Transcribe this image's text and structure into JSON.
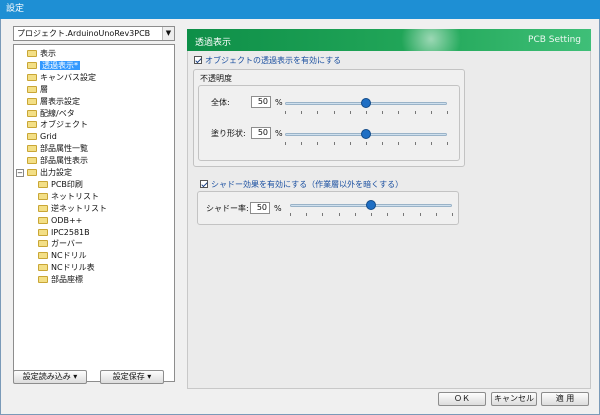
{
  "window": {
    "title": "設定"
  },
  "project_select": {
    "value": "プロジェクト.ArduinoUnoRev3PCB"
  },
  "tree": {
    "items": [
      {
        "label": "表示",
        "level": 0
      },
      {
        "label": "透過表示*",
        "level": 0,
        "selected": true
      },
      {
        "label": "キャンバス設定",
        "level": 0
      },
      {
        "label": "層",
        "level": 0
      },
      {
        "label": "層表示設定",
        "level": 0
      },
      {
        "label": "配線/ベタ",
        "level": 0
      },
      {
        "label": "オブジェクト",
        "level": 0
      },
      {
        "label": "Grid",
        "level": 0
      },
      {
        "label": "部品属性一覧",
        "level": 0
      },
      {
        "label": "部品属性表示",
        "level": 0
      },
      {
        "label": "出力設定",
        "level": 0,
        "expander": "−"
      },
      {
        "label": "PCB印刷",
        "level": 1
      },
      {
        "label": "ネットリスト",
        "level": 1
      },
      {
        "label": "逆ネットリスト",
        "level": 1
      },
      {
        "label": "ODB++",
        "level": 1
      },
      {
        "label": "IPC2581B",
        "level": 1
      },
      {
        "label": "ガーバー",
        "level": 1
      },
      {
        "label": "NCドリル",
        "level": 1
      },
      {
        "label": "NCドリル表",
        "level": 1
      },
      {
        "label": "部品座標",
        "level": 1
      }
    ]
  },
  "bottom_left": {
    "load_label": "設定読み込み ▾",
    "save_label": "設定保存 ▾"
  },
  "panel": {
    "title": "透過表示",
    "brand": "PCB Setting",
    "transparency_check": "オブジェクトの透過表示を有効にする",
    "opacity_group": "不透明度",
    "all_label": "全体:",
    "all_value": "50",
    "fill_label": "塗り形状:",
    "fill_value": "50",
    "unit": "%",
    "shadow_check": "シャドー効果を有効にする（作業層以外を暗くする）",
    "shadow_label": "シャドー率:",
    "shadow_value": "50",
    "slider_fraction": 0.5
  },
  "buttons": {
    "ok": "ＯＫ",
    "cancel": "キャンセル",
    "apply": "適 用"
  }
}
